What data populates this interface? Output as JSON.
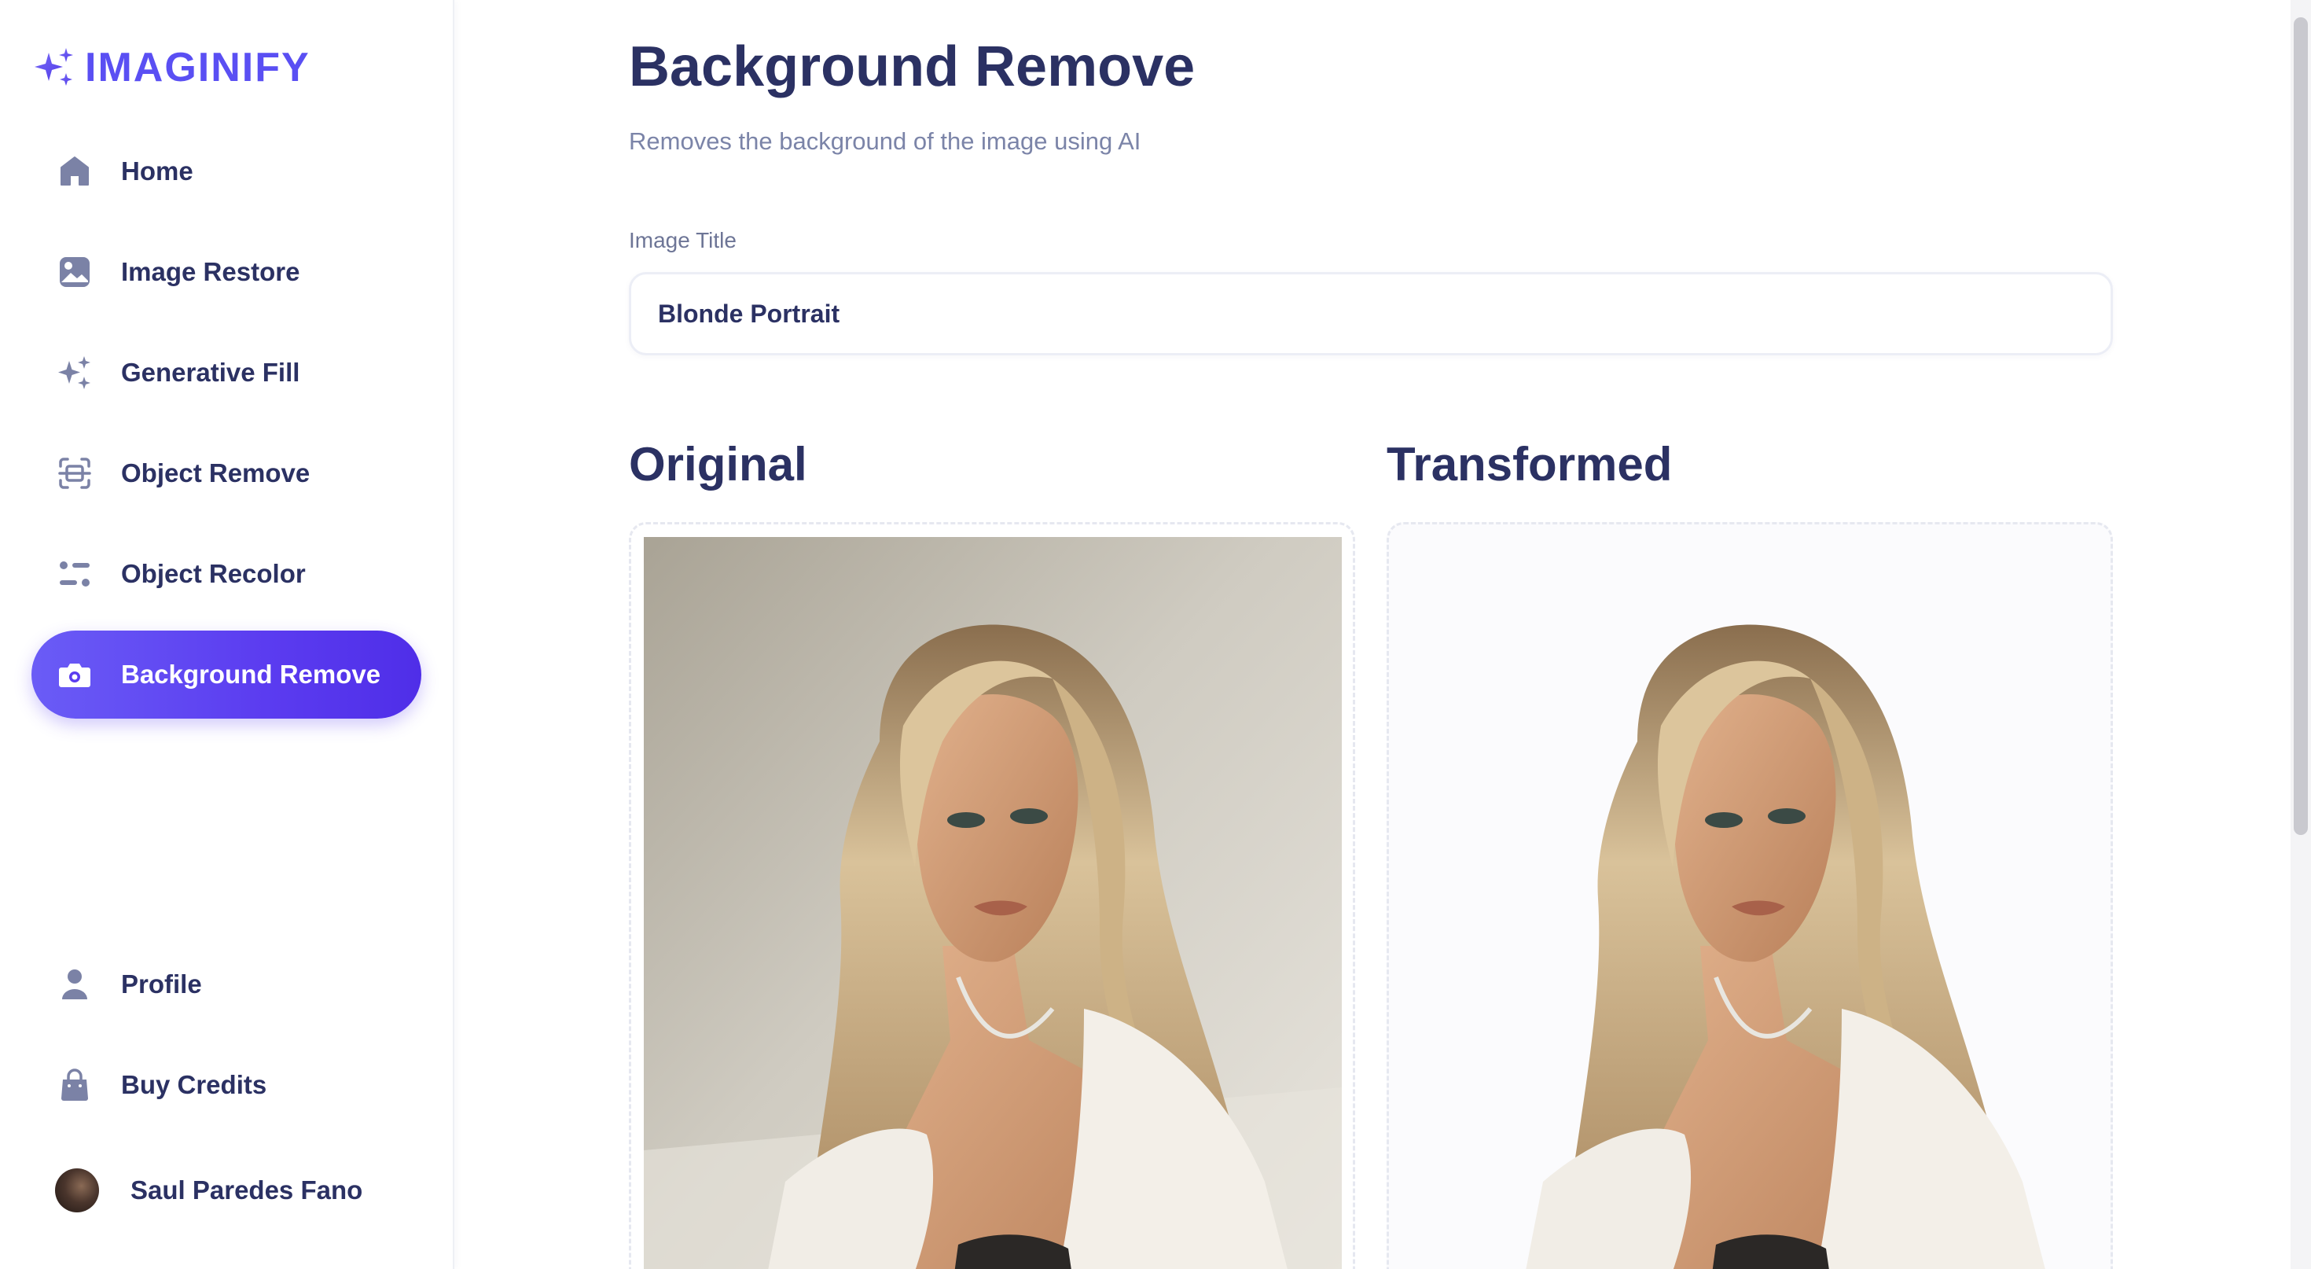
{
  "app": {
    "name": "IMAGINIFY",
    "brand_color": "#5a4ff3"
  },
  "sidebar": {
    "items": [
      {
        "label": "Home",
        "icon": "home-icon"
      },
      {
        "label": "Image Restore",
        "icon": "image-icon"
      },
      {
        "label": "Generative Fill",
        "icon": "sparkles-icon"
      },
      {
        "label": "Object Remove",
        "icon": "scan-icon"
      },
      {
        "label": "Object Recolor",
        "icon": "filter-icon"
      },
      {
        "label": "Background Remove",
        "icon": "camera-icon",
        "active": true
      }
    ],
    "bottom_items": [
      {
        "label": "Profile",
        "icon": "user-icon"
      },
      {
        "label": "Buy Credits",
        "icon": "bag-icon"
      }
    ],
    "user": {
      "name": "Saul Paredes Fano"
    }
  },
  "page": {
    "title": "Background Remove",
    "subtitle": "Removes the background of the image using AI"
  },
  "form": {
    "title_label": "Image Title",
    "title_value": "Blonde Portrait"
  },
  "panels": {
    "original_label": "Original",
    "transformed_label": "Transformed"
  }
}
